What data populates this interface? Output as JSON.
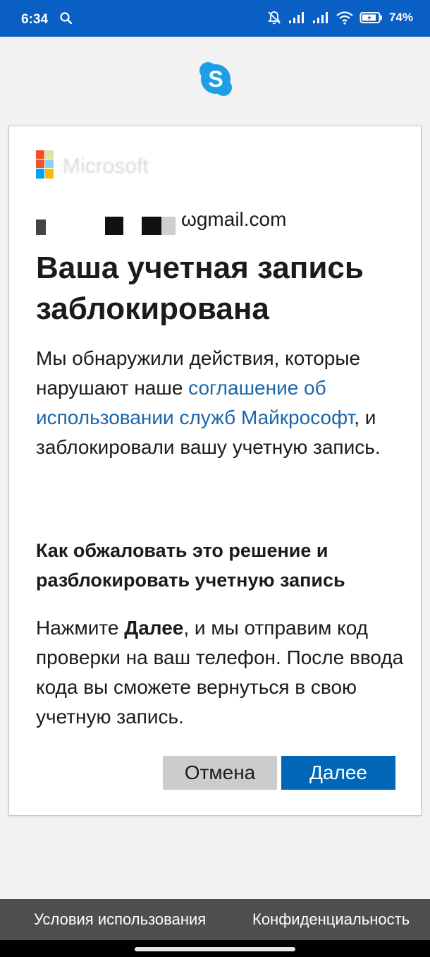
{
  "status_bar": {
    "time": "6:34",
    "battery": "74%",
    "icons": [
      "search-icon",
      "mute-icon",
      "signal-icon",
      "signal-icon",
      "wifi-icon",
      "battery-icon"
    ]
  },
  "app": {
    "logo": "skype-logo"
  },
  "card": {
    "brand": "Microsoft",
    "email": "s…@gmail.com",
    "email_visible_suffix": "ωgmail.com",
    "title": "Ваша учетная запись заблокирована",
    "body_part1": "Мы обнаружили действия, которые нарушают наше ",
    "body_link": "соглашение об использовании служб Майкрософт",
    "body_part2": ", и заблокировали вашу учетную запись.",
    "subheading": "Как обжаловать это решение и разблокировать учетную запись",
    "instr_part1": "Нажмите ",
    "instr_bold": "Далее",
    "instr_part2": ", и мы отправим код проверки на ваш телефон. После ввода кода вы сможете вернуться в свою учетную запись.",
    "cancel_label": "Отмена",
    "next_label": "Далее"
  },
  "footer": {
    "terms_label": "Условия использования",
    "privacy_label": "Конфиденциальность"
  },
  "colors": {
    "status_bar": "#0a5fc4",
    "link": "#1a66ab",
    "primary_button": "#0067b8",
    "secondary_button": "#cccccc",
    "footer": "#4f4f4f"
  }
}
